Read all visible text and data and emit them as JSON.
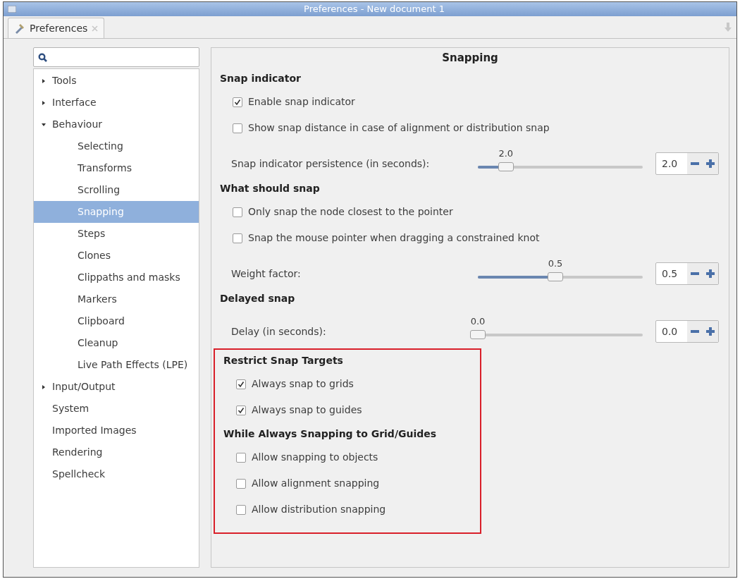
{
  "window": {
    "title": "Preferences - New document 1"
  },
  "tab": {
    "label": "Preferences",
    "selected": true
  },
  "sidebar": {
    "items": [
      {
        "label": "Tools",
        "kind": "group",
        "expanded": false,
        "selected": false
      },
      {
        "label": "Interface",
        "kind": "group",
        "expanded": false,
        "selected": false
      },
      {
        "label": "Behaviour",
        "kind": "group",
        "expanded": true,
        "selected": false,
        "children": [
          {
            "label": "Selecting",
            "selected": false
          },
          {
            "label": "Transforms",
            "selected": false
          },
          {
            "label": "Scrolling",
            "selected": false
          },
          {
            "label": "Snapping",
            "selected": true
          },
          {
            "label": "Steps",
            "selected": false
          },
          {
            "label": "Clones",
            "selected": false
          },
          {
            "label": "Clippaths and masks",
            "selected": false
          },
          {
            "label": "Markers",
            "selected": false
          },
          {
            "label": "Clipboard",
            "selected": false
          },
          {
            "label": "Cleanup",
            "selected": false
          },
          {
            "label": "Live Path Effects (LPE)",
            "selected": false
          }
        ]
      },
      {
        "label": "Input/Output",
        "kind": "group",
        "expanded": false,
        "selected": false
      },
      {
        "label": "System",
        "kind": "leaf",
        "selected": false
      },
      {
        "label": "Imported Images",
        "kind": "leaf",
        "selected": false
      },
      {
        "label": "Rendering",
        "kind": "leaf",
        "selected": false
      },
      {
        "label": "Spellcheck",
        "kind": "leaf",
        "selected": false
      }
    ]
  },
  "panel": {
    "title": "Snapping",
    "groups": [
      {
        "highlighted": false,
        "sections": [
          {
            "title": "Snap indicator",
            "rows": [
              {
                "kind": "checkbox",
                "label": "Enable snap indicator",
                "checked": true
              },
              {
                "kind": "checkbox",
                "label": "Show snap distance in case of alignment or distribution snap",
                "checked": false
              },
              {
                "kind": "slider",
                "label": "Snap indicator persistence (in seconds):",
                "reading": "2.0",
                "level": 0.17,
                "value": "2.0"
              }
            ]
          },
          {
            "title": "What should snap",
            "rows": [
              {
                "kind": "checkbox",
                "label": "Only snap the node closest to the pointer",
                "checked": false
              },
              {
                "kind": "checkbox",
                "label": "Snap the mouse pointer when dragging a constrained knot",
                "checked": false
              },
              {
                "kind": "slider",
                "label": "Weight factor:",
                "reading": "0.5",
                "level": 0.47,
                "value": "0.5"
              }
            ]
          },
          {
            "title": "Delayed snap",
            "rows": [
              {
                "kind": "slider",
                "label": "Delay (in seconds):",
                "reading": "0.0",
                "level": 0,
                "value": "0.0"
              }
            ]
          }
        ]
      },
      {
        "highlighted": true,
        "sections": [
          {
            "title": "Restrict Snap Targets",
            "rows": [
              {
                "kind": "checkbox",
                "label": "Always snap to grids",
                "checked": true
              },
              {
                "kind": "checkbox",
                "label": "Always snap to guides",
                "checked": true
              }
            ]
          },
          {
            "title": "While Always Snapping to Grid/Guides",
            "rows": [
              {
                "kind": "checkbox",
                "label": "Allow snapping to objects",
                "checked": false
              },
              {
                "kind": "checkbox",
                "label": "Allow alignment snapping",
                "checked": false
              },
              {
                "kind": "checkbox",
                "label": "Allow distribution snapping",
                "checked": false
              }
            ]
          }
        ]
      }
    ]
  }
}
